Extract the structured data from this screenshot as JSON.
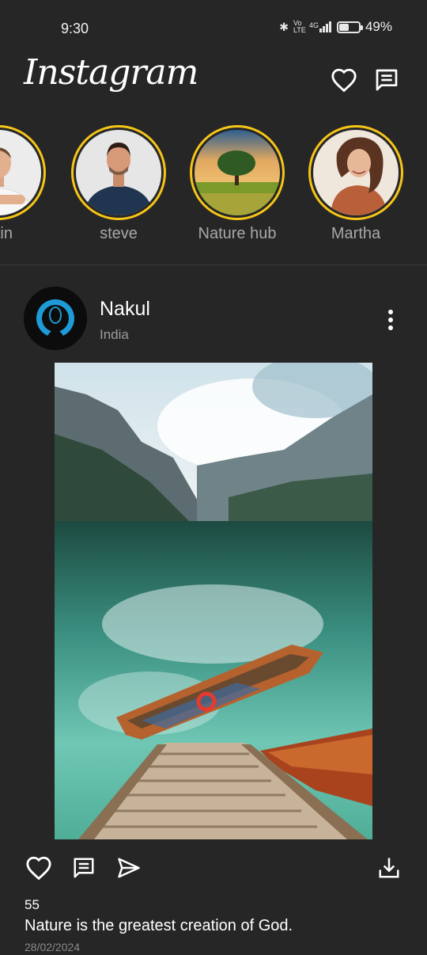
{
  "status_bar": {
    "time": "9:30",
    "bluetooth_icon": "bluetooth-icon",
    "volte_label": "Vo LTE",
    "network_label": "4G",
    "battery_level": 0.49,
    "battery_percent": "49%"
  },
  "header": {
    "logo": "Instagram",
    "icons": [
      "heart-icon",
      "message-icon"
    ]
  },
  "stories": [
    {
      "name": "Martin",
      "visible_name": "rtin"
    },
    {
      "name": "steve"
    },
    {
      "name": "Nature hub"
    },
    {
      "name": "Martha"
    }
  ],
  "post": {
    "username": "Nakul",
    "location": "India",
    "likes": "55",
    "caption": "Nature is the greatest creation of God.",
    "date": "28/02/2024",
    "actions": [
      "like-icon",
      "comment-icon",
      "share-icon",
      "download-icon"
    ]
  },
  "colors": {
    "background": "#262626",
    "story_ring": "#f5c518",
    "text_secondary": "#a8a8a8"
  }
}
